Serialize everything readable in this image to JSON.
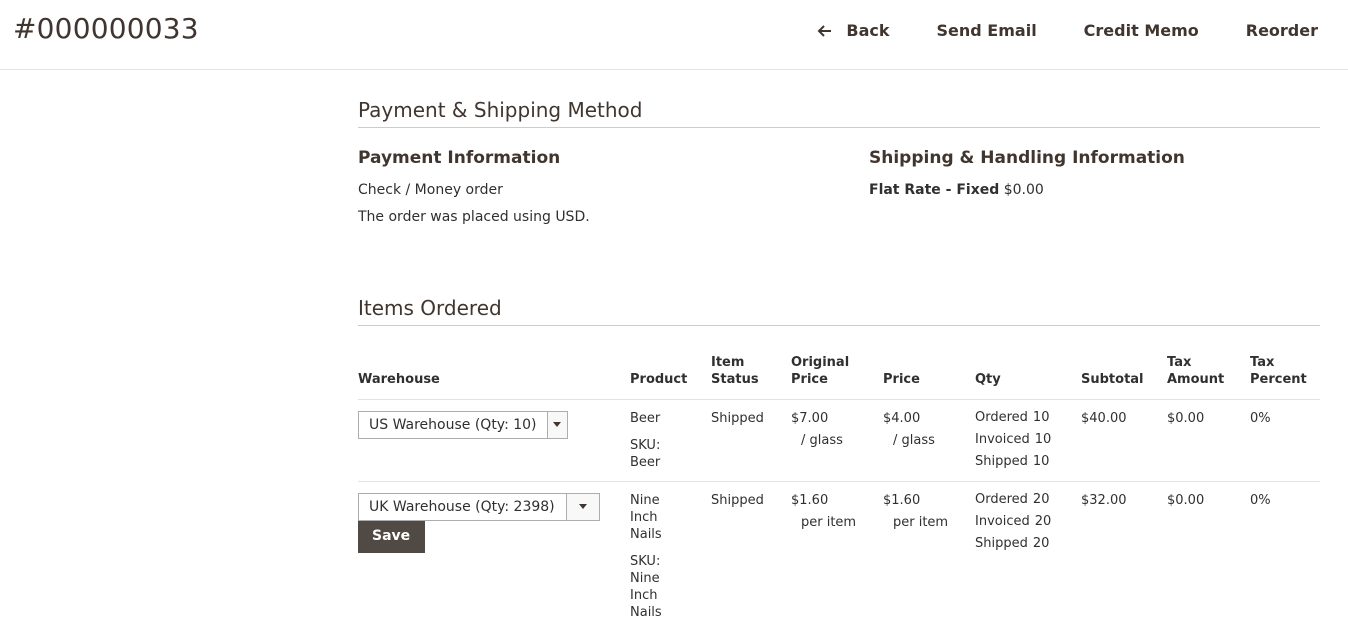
{
  "header": {
    "order_number": "#000000033",
    "actions": {
      "back": "Back",
      "send_email": "Send Email",
      "credit_memo": "Credit Memo",
      "reorder": "Reorder"
    }
  },
  "payment_shipping": {
    "title": "Payment & Shipping Method",
    "payment": {
      "title": "Payment Information",
      "method": "Check / Money order",
      "currency_note": "The order was placed using USD."
    },
    "shipping": {
      "title": "Shipping & Handling Information",
      "method_label": "Flat Rate - Fixed",
      "amount": "$0.00"
    }
  },
  "items_ordered": {
    "title": "Items Ordered",
    "columns": {
      "warehouse": "Warehouse",
      "product": "Product",
      "item_status_1": "Item",
      "item_status_2": "Status",
      "original_price_1": "Original",
      "original_price_2": "Price",
      "price": "Price",
      "qty": "Qty",
      "subtotal": "Subtotal",
      "tax_amount_1": "Tax",
      "tax_amount_2": "Amount",
      "tax_percent_1": "Tax",
      "tax_percent_2": "Percent"
    },
    "rows": [
      {
        "warehouse": "US Warehouse (Qty: 10)",
        "product_name": [
          "Beer"
        ],
        "sku_label": "SKU:",
        "sku": [
          "Beer"
        ],
        "status": "Shipped",
        "original_price": "$7.00",
        "original_unit": "/ glass",
        "price": "$4.00",
        "price_unit": "/ glass",
        "qty": [
          {
            "label": "Ordered",
            "value": "10"
          },
          {
            "label": "Invoiced",
            "value": "10"
          },
          {
            "label": "Shipped",
            "value": "10"
          }
        ],
        "subtotal": "$40.00",
        "tax_amount": "$0.00",
        "tax_percent": "0%"
      },
      {
        "warehouse": "UK Warehouse (Qty: 2398)",
        "save_label": "Save",
        "product_name": [
          "Nine",
          "Inch",
          "Nails"
        ],
        "sku_label": "SKU:",
        "sku": [
          "Nine",
          "Inch",
          "Nails"
        ],
        "status": "Shipped",
        "original_price": "$1.60",
        "original_unit": "per item",
        "price": "$1.60",
        "price_unit": "per item",
        "qty": [
          {
            "label": "Ordered",
            "value": "20"
          },
          {
            "label": "Invoiced",
            "value": "20"
          },
          {
            "label": "Shipped",
            "value": "20"
          }
        ],
        "subtotal": "$32.00",
        "tax_amount": "$0.00",
        "tax_percent": "0%"
      }
    ]
  },
  "icons": {
    "back": "arrow-left-icon",
    "dropdown": "caret-down-icon"
  }
}
